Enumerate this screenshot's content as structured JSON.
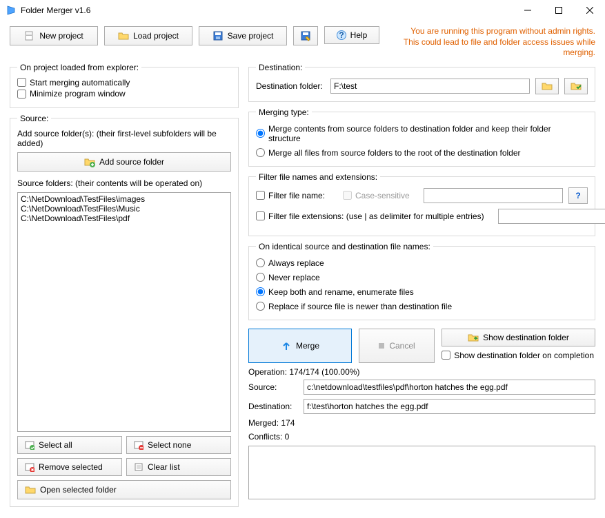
{
  "window": {
    "title": "Folder Merger v1.6"
  },
  "toolbar": {
    "new_project": "New project",
    "load_project": "Load project",
    "save_project": "Save project",
    "help": "Help"
  },
  "warning": {
    "line1": "You are running this program without admin rights.",
    "line2": "This could lead to file and folder access issues while merging."
  },
  "explorer_group": {
    "legend": "On project loaded from explorer:",
    "start_auto": "Start merging automatically",
    "minimize": "Minimize program window"
  },
  "source_group": {
    "legend": "Source:",
    "add_label": "Add source folder(s): (their first-level subfolders will be added)",
    "add_button": "Add source folder",
    "list_label": "Source folders: (their contents will be operated on)",
    "items": [
      "C:\\NetDownload\\TestFiles\\images",
      "C:\\NetDownload\\TestFiles\\Music",
      "C:\\NetDownload\\TestFiles\\pdf"
    ],
    "select_all": "Select all",
    "select_none": "Select none",
    "remove_selected": "Remove selected",
    "clear_list": "Clear list",
    "open_selected": "Open selected folder"
  },
  "destination_group": {
    "legend": "Destination:",
    "label": "Destination folder:",
    "value": "F:\\test"
  },
  "merging_type_group": {
    "legend": "Merging type:",
    "opt1": "Merge contents from source folders to destination folder and keep their folder structure",
    "opt2": "Merge all files from source folders to the root of the destination folder"
  },
  "filter_group": {
    "legend": "Filter file names and extensions:",
    "filter_name": "Filter file name:",
    "case_sensitive": "Case-sensitive",
    "filter_ext": "Filter file extensions: (use | as delimiter for multiple entries)"
  },
  "identical_group": {
    "legend": "On identical source and destination file names:",
    "opt1": "Always replace",
    "opt2": "Never replace",
    "opt3": "Keep both and rename, enumerate files",
    "opt4": "Replace if source file is newer than destination file"
  },
  "actions": {
    "merge": "Merge",
    "cancel": "Cancel",
    "show_dest": "Show destination folder",
    "show_on_complete": "Show destination folder on completion"
  },
  "status": {
    "operation": "Operation: 174/174 (100.00%)",
    "source_label": "Source:",
    "source_value": "c:\\netdownload\\testfiles\\pdf\\horton hatches the egg.pdf",
    "dest_label": "Destination:",
    "dest_value": "f:\\test\\horton hatches the egg.pdf",
    "merged": "Merged: 174",
    "conflicts": "Conflicts: 0"
  }
}
